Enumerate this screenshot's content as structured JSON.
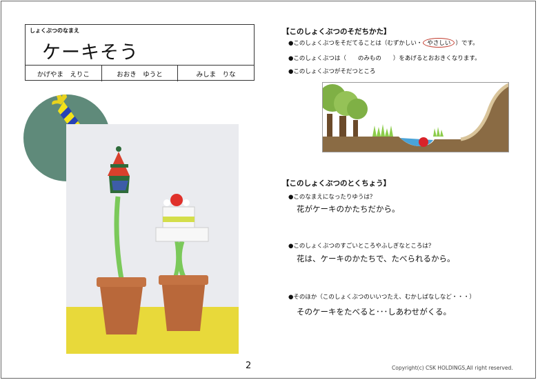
{
  "name_section": {
    "caption": "しょくぶつのなまえ",
    "plant_name": "ケーキそう",
    "authors": [
      "かげやま　えりこ",
      "おおき　ゆうと",
      "みしま　りな"
    ]
  },
  "growth": {
    "heading": "【このしょくぶつのそだちかた】",
    "difficulty_prefix": "●このしょくぶつをそだてることは（むずかしい・",
    "difficulty_circled": "やさしい",
    "difficulty_suffix": "）です。",
    "food": "●このしょくぶつは（　　のみもの　　）をあげるとおおきくなります。",
    "place": "●このしょくぶつがそだつところ"
  },
  "features": {
    "heading": "【このしょくぶつのとくちょう】",
    "q1": "●このなまえになったりゆうは？",
    "a1": "花がケーキのかたちだから。",
    "q2": "●このしょくぶつのすごいところやふしぎなところは？",
    "a2": "花は、ケーキのかたちで、たべられるから。",
    "q3": "●そのほか（このしょくぶつのいいつたえ、むかしばなしなど・・・）",
    "a3": "そのケーキをたべると･･･しあわせがくる。"
  },
  "footer": {
    "page_number": "2",
    "copyright": "Copyright(c) CSK HOLDINGS,All right reserved."
  },
  "colors": {
    "circle_bg": "#5f8a7a",
    "stem_green": "#7bc95a",
    "pot": "#b9683a",
    "ground": "#8a6b44",
    "tree_green": "#7fb045",
    "circle_mark": "#c0392b"
  }
}
